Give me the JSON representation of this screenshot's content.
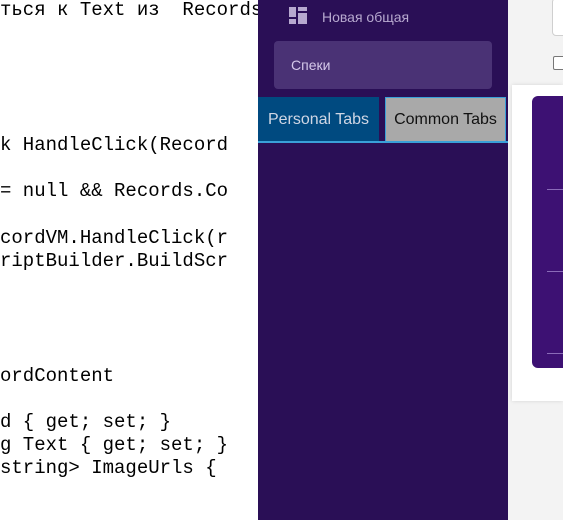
{
  "code_editor": {
    "lines": [
      "ться к Text из  Records",
      "k HandleClick(Record",
      "= null && Records.Co",
      "cordVM.HandleClick(r",
      "riptBuilder.BuildScr",
      "ordContent",
      "d { get; set; }",
      "g Text { get; set; }",
      "string> ImageUrls {"
    ]
  },
  "drawer": {
    "title": "Новая общая",
    "icon": "dashboard-grid-icon",
    "search": {
      "text": "Спеки"
    },
    "tabs": [
      {
        "label": "Personal Tabs",
        "active": true
      },
      {
        "label": "Common Tabs",
        "active": false
      }
    ]
  },
  "colors": {
    "drawer_bg": "#2a0f56",
    "personal_tab": "#004a80",
    "common_tab": "#a9a9a9",
    "accent": "#3aa0d8",
    "bg_panel": "#3d1173"
  }
}
